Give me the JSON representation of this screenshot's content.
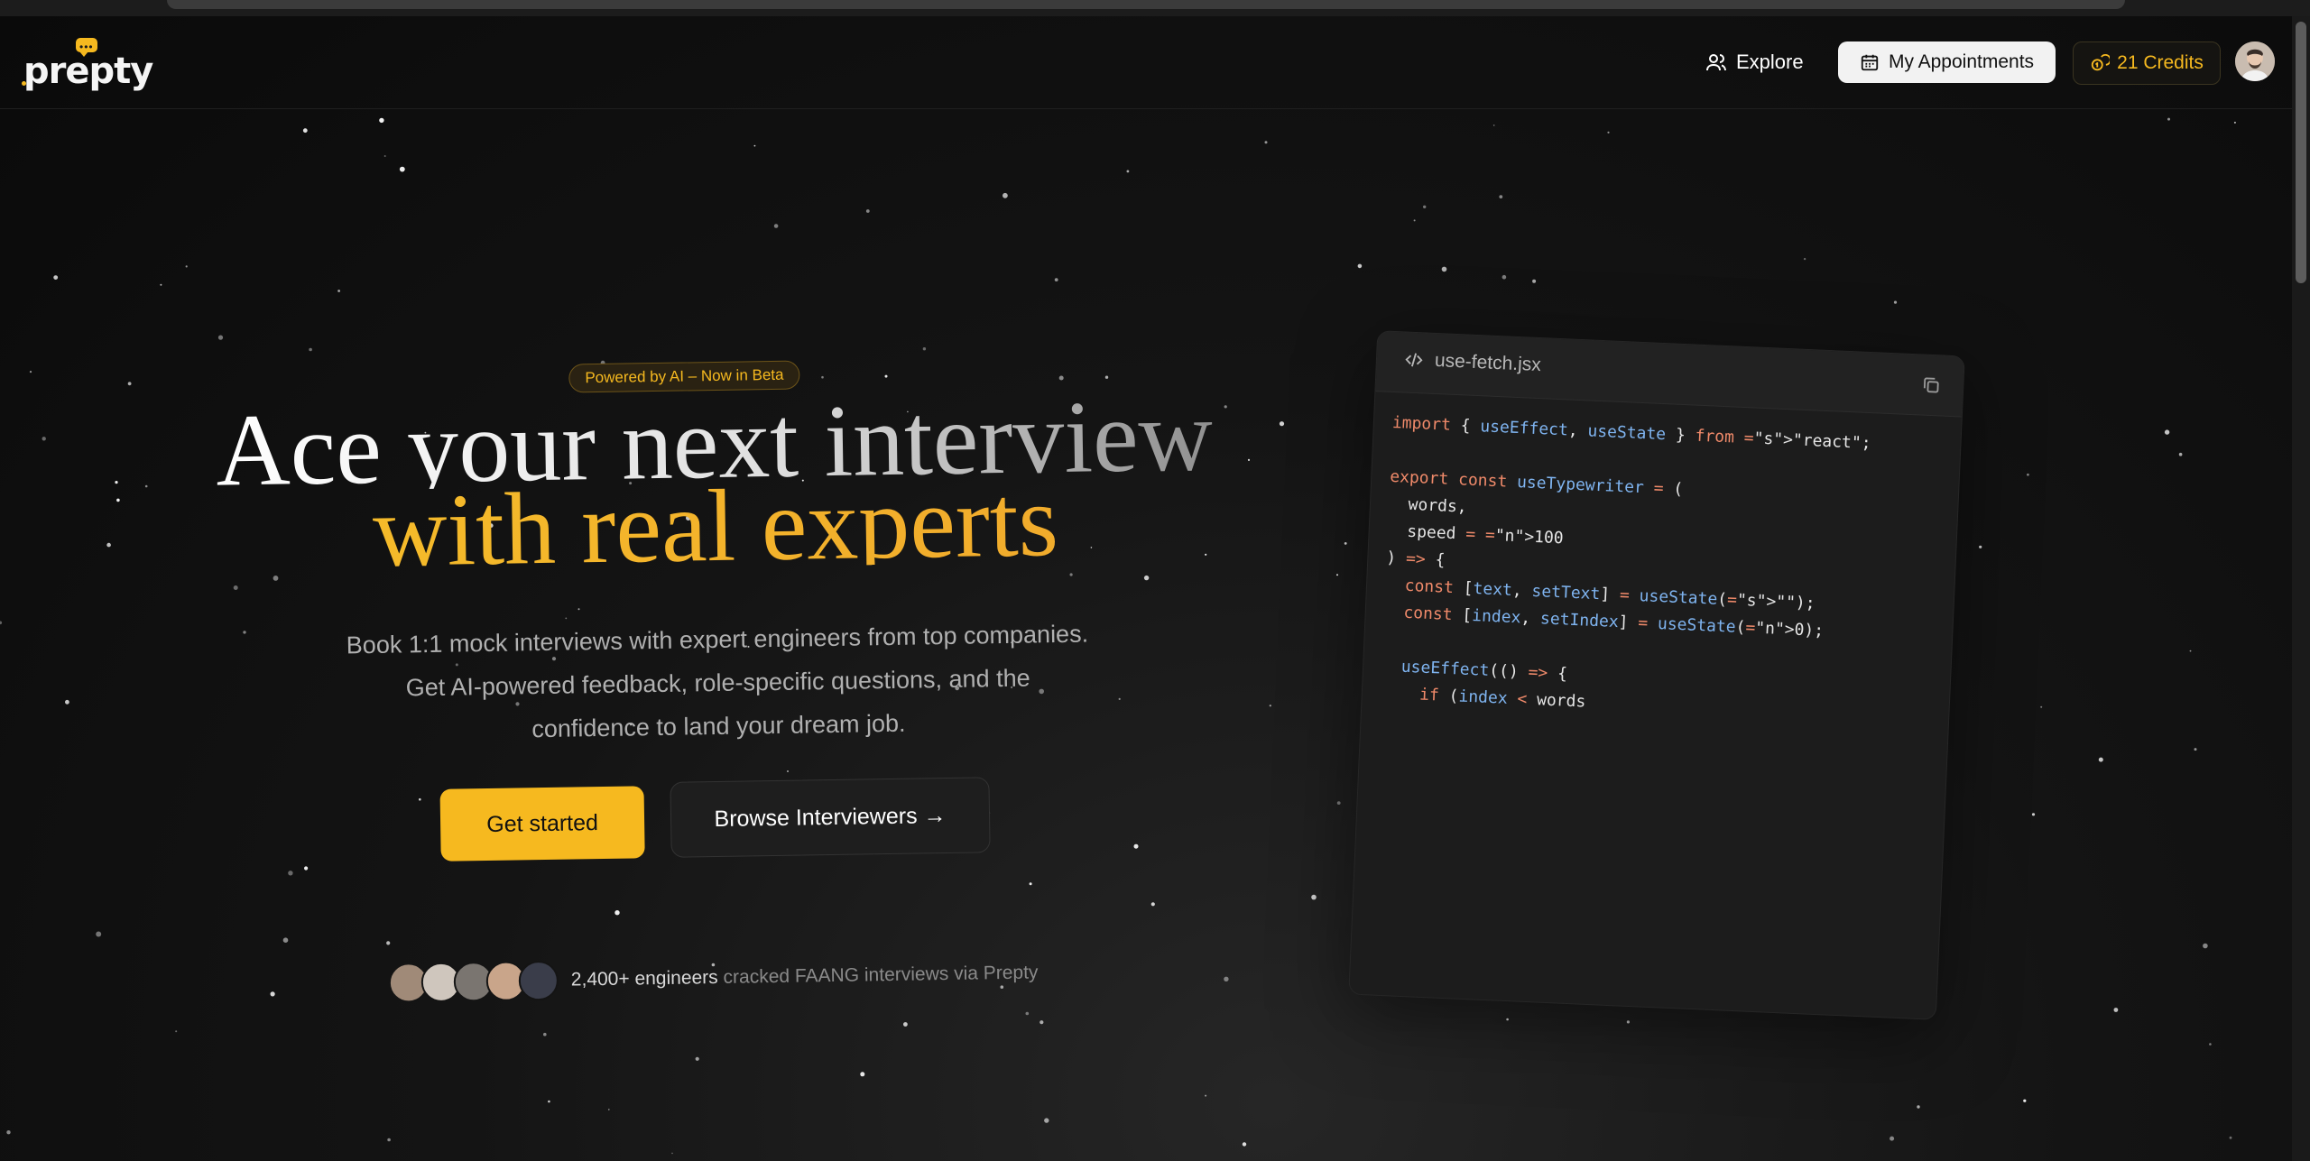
{
  "app": {
    "logo_text": "prepty"
  },
  "nav": {
    "explore": "Explore",
    "appointments": "My Appointments",
    "credits": "21 Credits"
  },
  "hero": {
    "badge": "Powered by AI – Now in Beta",
    "title_line1": "Ace your next interview",
    "title_line2": "with real experts",
    "subtitle_line1": "Book 1:1 mock interviews with expert engineers from top companies.",
    "subtitle_line2": "Get AI-powered feedback, role-specific questions, and the",
    "subtitle_line3": "confidence to land your dream job.",
    "cta_primary": "Get started",
    "cta_secondary": "Browse Interviewers →",
    "social_count": "2,400+ engineers",
    "social_rest": "cracked FAANG interviews via Prepty"
  },
  "code_card": {
    "filename": "use-fetch.jsx",
    "lines": [
      "import { useEffect, useState } from \"react\";",
      "",
      "export const useTypewriter = (",
      "  words,",
      "  speed = 100",
      ") => {",
      "  const [text, setText] = useState(\"\");",
      "  const [index, setIndex] = useState(0);",
      "",
      "  useEffect(() => {",
      "    if (index < words"
    ]
  },
  "colors": {
    "accent": "#f6b91f",
    "background": "#0d0d0d",
    "card": "#1c1c1c"
  }
}
